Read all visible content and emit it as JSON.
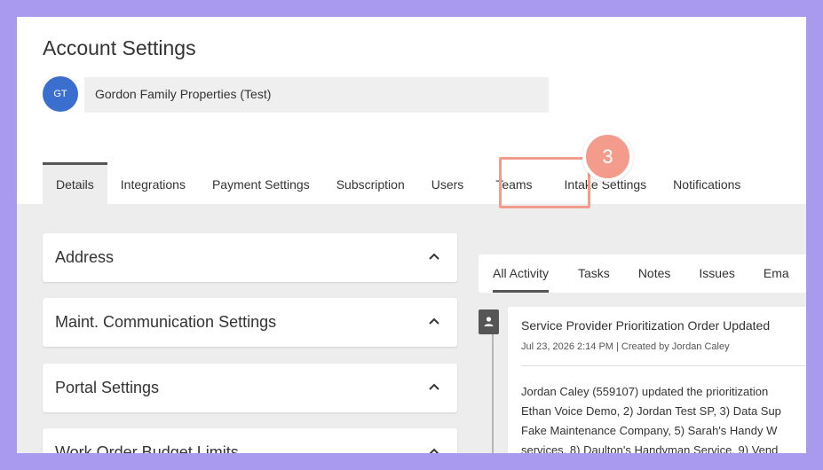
{
  "page": {
    "title": "Account Settings"
  },
  "account": {
    "initials": "GT",
    "name": "Gordon Family Properties (Test)"
  },
  "tabs": [
    {
      "label": "Details",
      "active": true
    },
    {
      "label": "Integrations",
      "active": false
    },
    {
      "label": "Payment Settings",
      "active": false
    },
    {
      "label": "Subscription",
      "active": false
    },
    {
      "label": "Users",
      "active": false
    },
    {
      "label": "Teams",
      "active": false
    },
    {
      "label": "Intake Settings",
      "active": false
    },
    {
      "label": "Notifications",
      "active": false
    }
  ],
  "annotation": {
    "step_number": "3",
    "highlight_color": "#f39c8c"
  },
  "sections": [
    {
      "label": "Address",
      "icon": "chevron-up-icon"
    },
    {
      "label": "Maint. Communication Settings",
      "icon": "chevron-up-icon"
    },
    {
      "label": "Portal Settings",
      "icon": "chevron-up-icon"
    },
    {
      "label": "Work Order Budget Limits",
      "icon": "chevron-up-icon"
    }
  ],
  "activity": {
    "tabs": [
      {
        "label": "All Activity",
        "active": true
      },
      {
        "label": "Tasks",
        "active": false
      },
      {
        "label": "Notes",
        "active": false
      },
      {
        "label": "Issues",
        "active": false
      },
      {
        "label": "Ema",
        "active": false
      }
    ],
    "entry": {
      "icon": "person-icon",
      "title": "Service Provider Prioritization Order Updated",
      "meta": "Jul 23, 2026 2:14 PM | Created by Jordan Caley",
      "body_lines": [
        "Jordan Caley (559107) updated the prioritization",
        "Ethan Voice Demo, 2) Jordan Test SP, 3) Data Sup",
        "Fake Maintenance Company, 5) Sarah's Handy W",
        "services, 8) Daulton's Handyman Service, 9) Vend"
      ]
    }
  },
  "colors": {
    "background": "#a99af0",
    "avatar": "#3a6fd0",
    "highlight": "#f39c8c"
  }
}
